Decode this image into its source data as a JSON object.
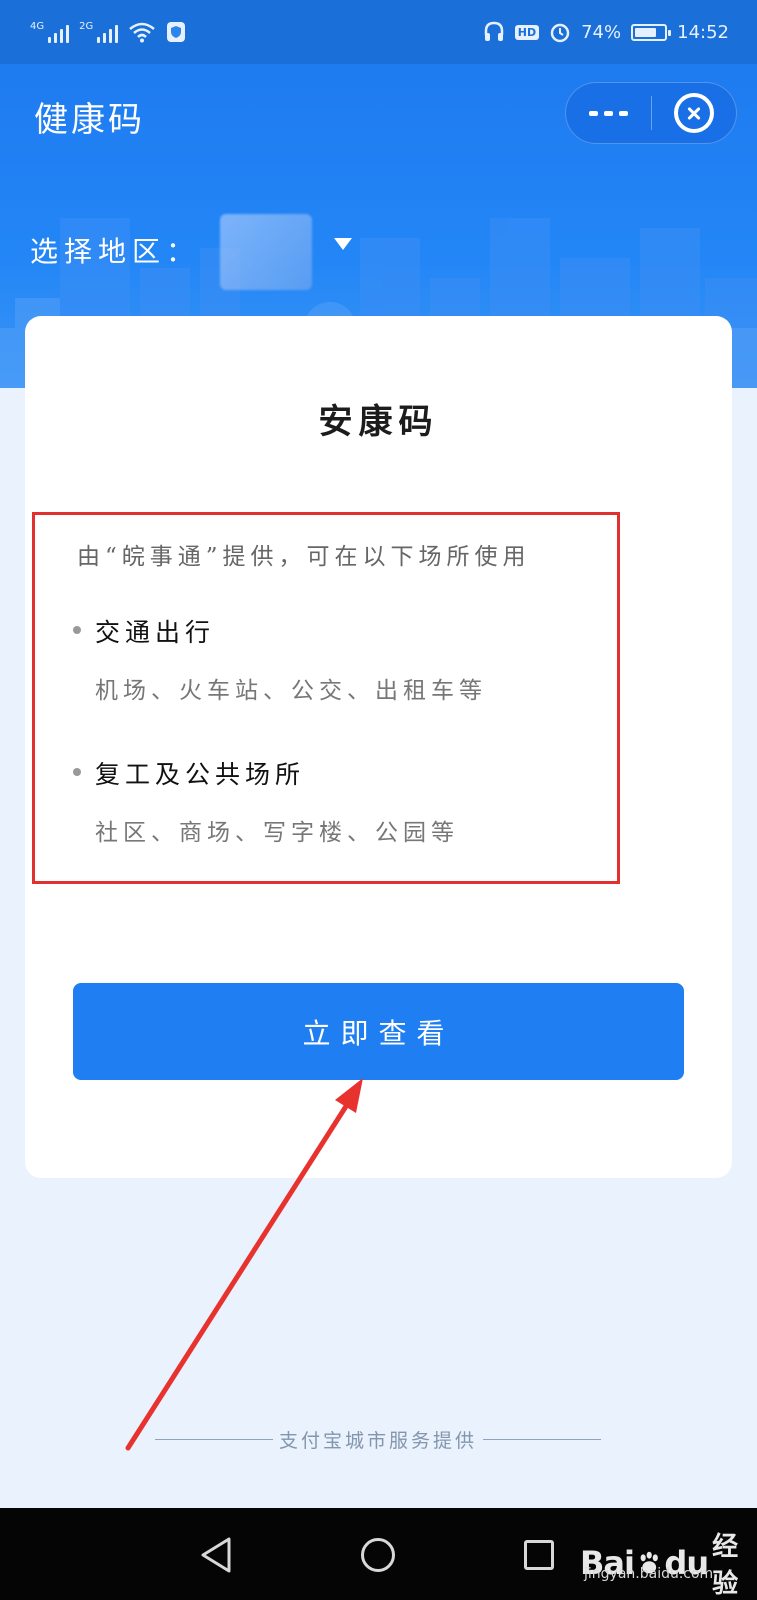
{
  "status_bar": {
    "network_1": "4G",
    "network_2": "2G",
    "battery": "74%",
    "time": "14:52",
    "hd": "HD"
  },
  "header": {
    "title": "健康码",
    "region_label": "选择地区：",
    "brand_color": "#1e7bf0"
  },
  "card": {
    "title": "安康码",
    "provider_text": "由“皖事通”提供，可在以下场所使用",
    "groups": [
      {
        "heading": "交通出行",
        "description": "机场、火车站、公交、出租车等"
      },
      {
        "heading": "复工及公共场所",
        "description": "社区、商场、写字楼、公园等"
      }
    ],
    "button_label": "立即查看",
    "button_color": "#1f7ef1",
    "annotation_color": "#e03030"
  },
  "footer": {
    "text": "支付宝城市服务提供"
  },
  "watermark": {
    "brand": "Bai",
    "brand_tail": "du",
    "product": "经验",
    "url": "jingyan.baidu.com"
  }
}
